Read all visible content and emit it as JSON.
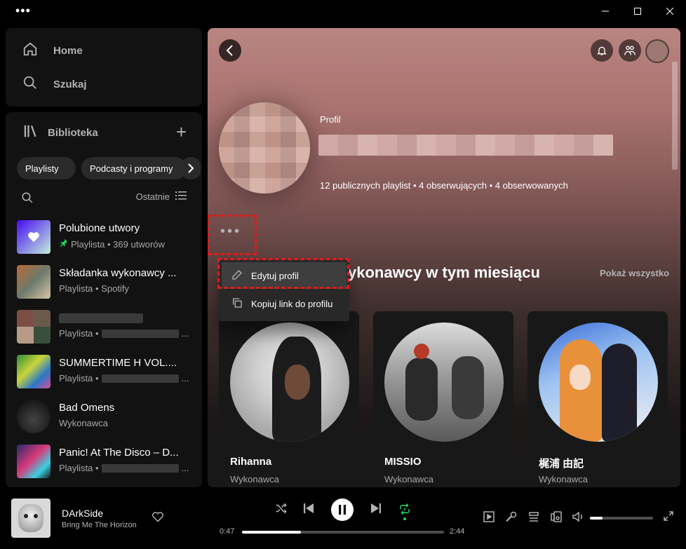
{
  "window": {
    "menu_icon": "more-horizontal-icon"
  },
  "nav": {
    "home_label": "Home",
    "search_label": "Szukaj"
  },
  "library": {
    "title": "Biblioteka",
    "chips": [
      "Playlisty",
      "Podcasty i programy"
    ],
    "sort_label": "Ostatnie",
    "items": [
      {
        "title": "Polubione utwory",
        "sub": "Playlista • 369 utworów",
        "pinned": true
      },
      {
        "title": "Składanka wykonawcy ...",
        "sub": "Playlista • Spotify"
      },
      {
        "title": "",
        "sub_prefix": "Playlista •",
        "sub_suffix": "..."
      },
      {
        "title": "SUMMERTIME H VOL....",
        "sub_prefix": "Playlista •",
        "sub_suffix": "..."
      },
      {
        "title": "Bad Omens",
        "sub": "Wykonawca"
      },
      {
        "title": "Panic! At The Disco – D...",
        "sub_prefix": "Playlista •",
        "sub_suffix": "..."
      }
    ]
  },
  "profile": {
    "type_label": "Profil",
    "stats_playlists": "12 publicznych playlist",
    "stats_sep1": " • ",
    "stats_followers": "4 obserwujących",
    "stats_sep2": " • ",
    "stats_following": "4 obserwowanych"
  },
  "section": {
    "title": "ykonawcy w tym miesiącu",
    "show_all": "Pokaż wszystko"
  },
  "context_menu": {
    "edit_profile": "Edytuj profil",
    "copy_link": "Kopiuj link do profilu"
  },
  "artists": [
    {
      "name": "Rihanna",
      "sub": "Wykonawca"
    },
    {
      "name": "MISSIO",
      "sub": "Wykonawca"
    },
    {
      "name": "梶浦 由記",
      "sub": "Wykonawca"
    }
  ],
  "player": {
    "track": "DArkSide",
    "artist": "Bring Me The Horizon",
    "elapsed": "0:47",
    "duration": "2:44",
    "progress": 0.29,
    "volume": 0.2
  },
  "colors": {
    "accent_green": "#1ed760",
    "highlight_red": "#e01b1b"
  }
}
